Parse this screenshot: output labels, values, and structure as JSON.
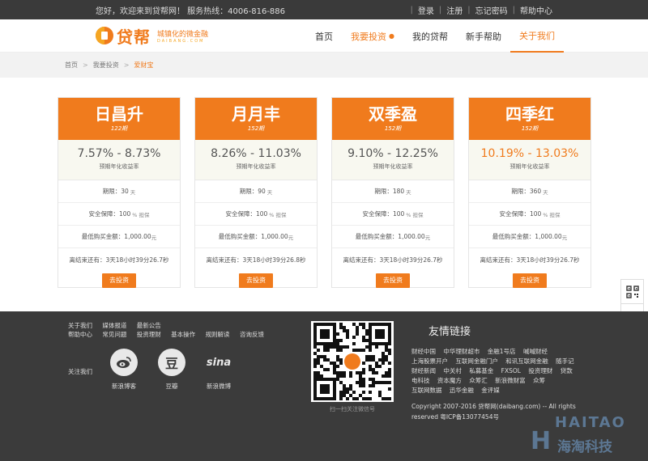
{
  "topbar": {
    "greeting": "您好，欢迎来到贷帮网！ 服务热线：4006-816-886",
    "login": "登录",
    "register": "注册",
    "forgot": "忘记密码",
    "help": "帮助中心"
  },
  "header": {
    "logo_text": "贷帮",
    "slogan": "城镇化的微金融",
    "slogan_en": "DAIBANG.COM",
    "nav": [
      {
        "label": "首页"
      },
      {
        "label": "我要投资"
      },
      {
        "label": "我的贷帮"
      },
      {
        "label": "新手帮助"
      },
      {
        "label": "关于我们"
      }
    ]
  },
  "breadcrumb": [
    "首页",
    "我要投资",
    "爱财宝"
  ],
  "products": [
    {
      "name": "日昌升",
      "code": "122期",
      "rate": "7.57% - 8.73%",
      "rate_label": "预期年化收益率",
      "term": "期限：30",
      "term_unit": "天",
      "guarantee": "安全保障：100",
      "guarantee_unit": "% 担保",
      "min": "最低购买金额：1,000.00",
      "min_unit": "元",
      "countdown": "离结束还有：3天18小时39分26.7秒",
      "button": "去投资"
    },
    {
      "name": "月月丰",
      "code": "152期",
      "rate": "8.26% - 11.03%",
      "rate_label": "预期年化收益率",
      "term": "期限：90",
      "term_unit": "天",
      "guarantee": "安全保障：100",
      "guarantee_unit": "% 担保",
      "min": "最低购买金额：1,000.00",
      "min_unit": "元",
      "countdown": "离结束还有：3天18小时39分26.8秒",
      "button": "去投资"
    },
    {
      "name": "双季盈",
      "code": "152期",
      "rate": "9.10% - 12.25%",
      "rate_label": "预期年化收益率",
      "term": "期限：180",
      "term_unit": "天",
      "guarantee": "安全保障：100",
      "guarantee_unit": "% 担保",
      "min": "最低购买金额：1,000.00",
      "min_unit": "元",
      "countdown": "离结束还有：3天18小时39分26.7秒",
      "button": "去投资"
    },
    {
      "name": "四季红",
      "code": "152期",
      "rate": "10.19% - 13.03%",
      "rate_label": "预期年化收益率",
      "term": "期限：360",
      "term_unit": "天",
      "guarantee": "安全保障：100",
      "guarantee_unit": "% 担保",
      "min": "最低购买金额：1,000.00",
      "min_unit": "元",
      "countdown": "离结束还有：3天18小时39分26.7秒",
      "button": "去投资"
    }
  ],
  "footer": {
    "links_row1": [
      "关于我们",
      "媒体报道",
      "最新公告"
    ],
    "links_row2": [
      "帮助中心",
      "常见问题",
      "投资理财",
      "基本操作",
      "规则解读",
      "咨询反馈"
    ],
    "follow_label": "关注我们",
    "social": [
      {
        "icon": "weibo-icon",
        "glyph": "◉",
        "caption": "新浪博客"
      },
      {
        "icon": "douban-icon",
        "glyph": "豆",
        "caption": "豆瓣"
      },
      {
        "icon": "sina-icon",
        "glyph": "sina",
        "caption": "新浪微博"
      }
    ],
    "qr_caption": "扫一扫关注微信号",
    "friend_title": "友情链接",
    "friend_links": [
      "财经中国",
      "中华理财超市",
      "金融1号店",
      "喊喊财经",
      "上海股票开户",
      "互联网金融门户",
      "和讯互联网金融",
      "随手记",
      "财经新闻",
      "中关村",
      "私募基金",
      "FXSOL",
      "投资理财",
      "贷款",
      "电科技",
      "资本魔方",
      "众筹汇",
      "新浪微财富",
      "众筹",
      "互联网数据",
      "迅华金融",
      "金评媒"
    ],
    "copyright": "Copyright 2007-2016 贷帮网(daibang.com) -- All rights reserved 粤ICP备13077454号"
  },
  "watermark": {
    "en": "HAITAO",
    "cn": "海淘科技",
    "mark": "H"
  },
  "colors": {
    "accent": "#f07b1d",
    "footer_bg": "#3b3b3b",
    "topbar_bg": "#3a3a3a"
  }
}
